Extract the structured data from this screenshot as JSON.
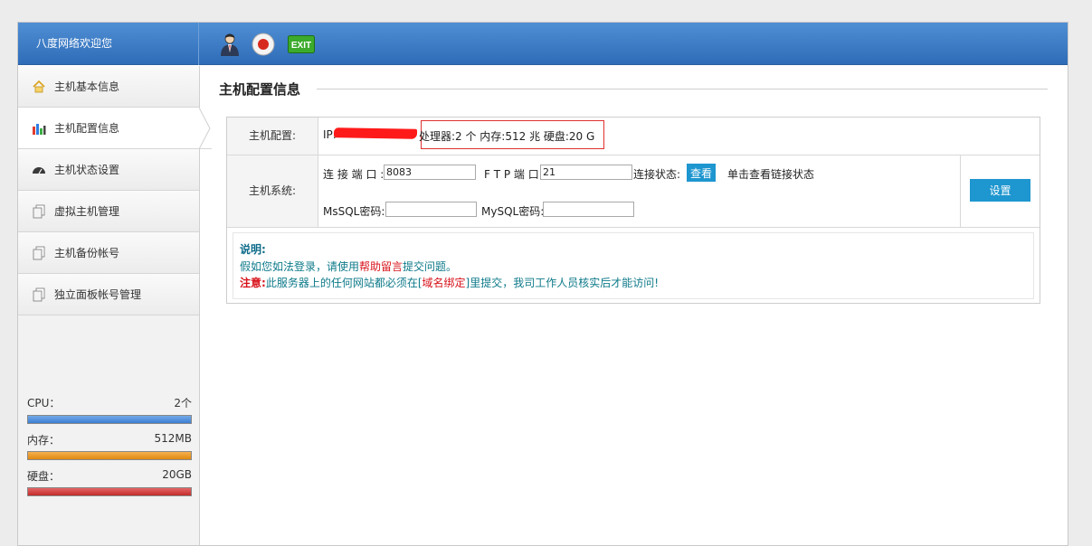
{
  "header": {
    "welcome": "八度网络欢迎您",
    "exit_label": "EXIT"
  },
  "sidebar": {
    "items": [
      {
        "label": "主机基本信息",
        "icon": "home-icon"
      },
      {
        "label": "主机配置信息",
        "icon": "bar-chart-icon",
        "active": true
      },
      {
        "label": "主机状态设置",
        "icon": "gauge-icon"
      },
      {
        "label": "虚拟主机管理",
        "icon": "pages-icon"
      },
      {
        "label": "主机备份帐号",
        "icon": "pages-icon"
      },
      {
        "label": "独立面板帐号管理",
        "icon": "pages-icon"
      }
    ],
    "stats": {
      "cpu": {
        "label": "CPU：",
        "value": "2个"
      },
      "memory": {
        "label": "内存：",
        "value": "512MB"
      },
      "disk": {
        "label": "硬盘：",
        "value": "20GB"
      }
    }
  },
  "main": {
    "title": "主机配置信息",
    "config": {
      "label": "主机配置:",
      "ip_prefix": "IP:",
      "specs": "处理器:2 个 内存:512 兆 硬盘:20 G"
    },
    "system": {
      "label": "主机系统:",
      "port_label": "连 接 端 口 :",
      "port_value": "8083",
      "ftp_label": "F T P 端 口:",
      "ftp_value": "21",
      "status_label": "连接状态:",
      "view_button": "查看",
      "status_hint": "单击查看链接状态",
      "mssql_label": "MsSQL密码:",
      "mssql_value": "",
      "mysql_label": "MySQL密码:",
      "mysql_value": "",
      "set_button": "设置"
    },
    "notes": {
      "heading": "说明:",
      "line1_a": "假如您如法登录，请使用",
      "line1_link": "帮助留言",
      "line1_b": "提交问题。",
      "line2_warn": "注意:",
      "line2_a": "此服务器上的任何网站都必须在[",
      "line2_link": "域名绑定",
      "line2_b": "]里提交，我司工作人员核实后才能访问!"
    }
  },
  "colors": {
    "accent": "#1e96cf",
    "header_blue": "#3a78c2",
    "link_red": "#d8141c",
    "note_teal": "#0e7a8a"
  }
}
